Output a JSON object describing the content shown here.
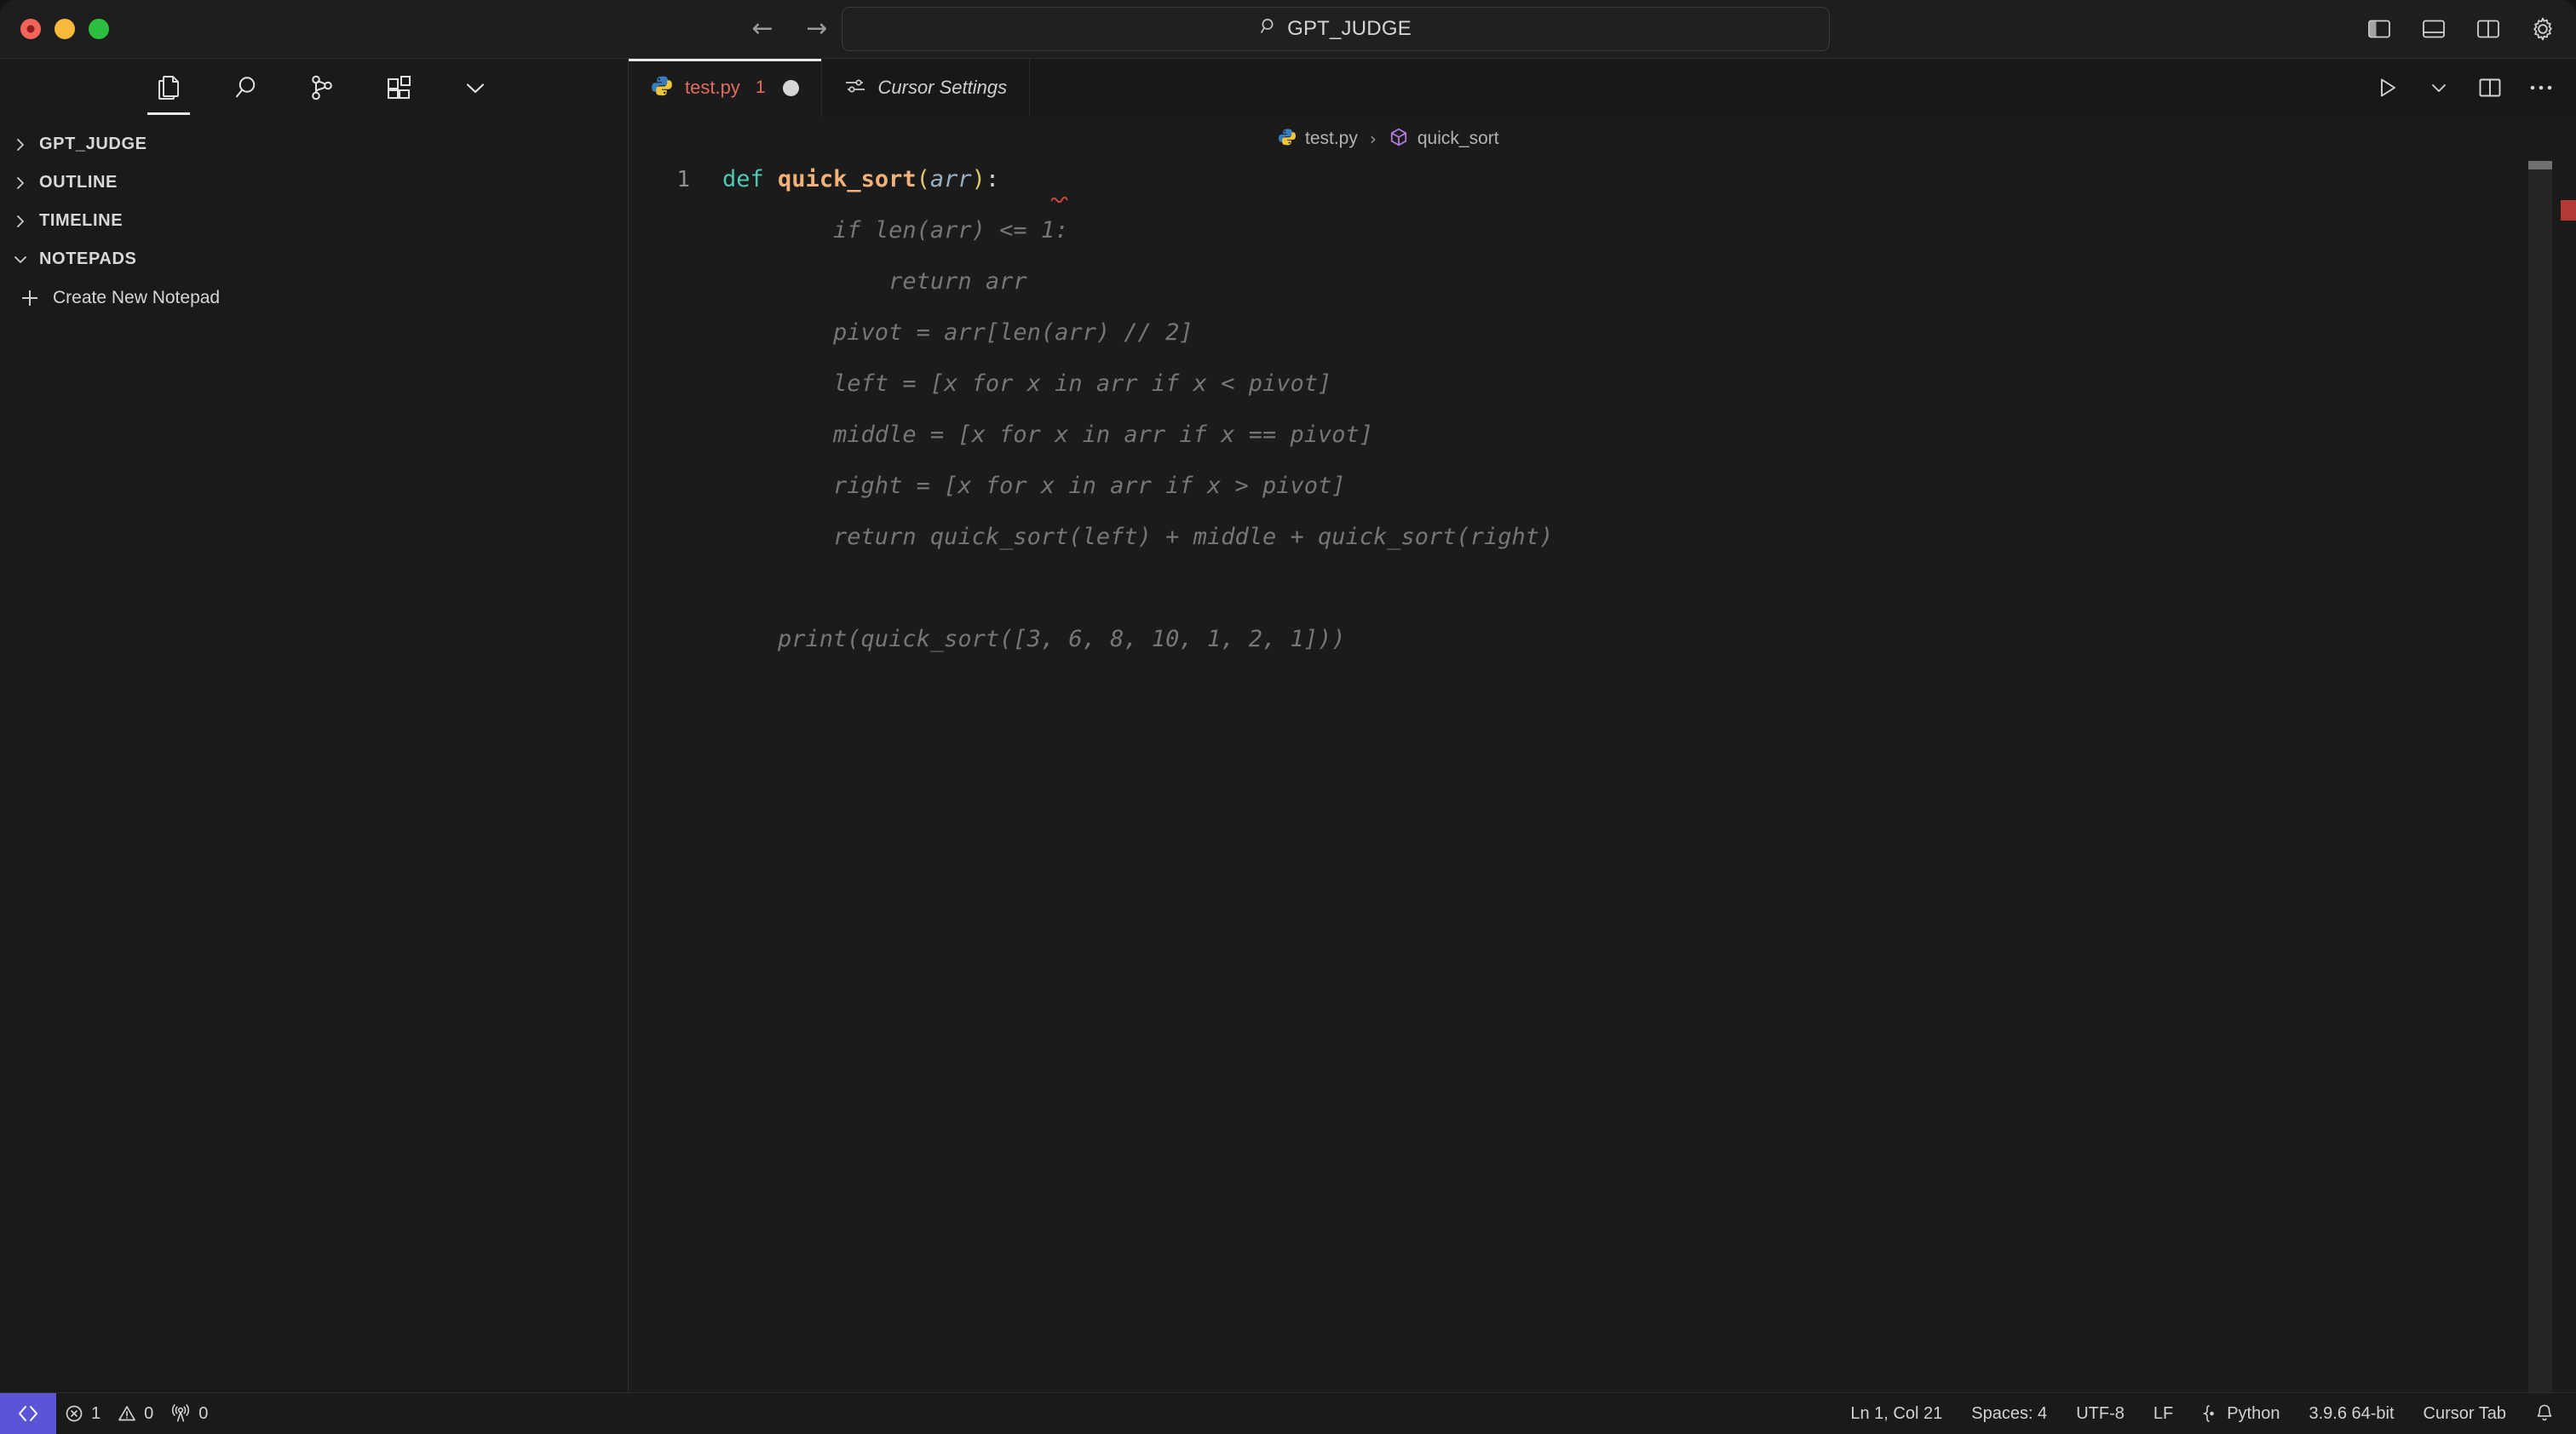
{
  "window": {
    "traffic_lights": [
      "close",
      "minimize",
      "maximize"
    ]
  },
  "titlebar": {
    "back_arrow": "←",
    "forward_arrow": "→",
    "search": {
      "icon": "search-icon",
      "value": "GPT_JUDGE"
    },
    "right_icons": [
      {
        "name": "toggle-primary-sidebar-icon",
        "title": "Toggle Primary Side Bar"
      },
      {
        "name": "toggle-panel-icon",
        "title": "Toggle Panel"
      },
      {
        "name": "toggle-secondary-sidebar-icon",
        "title": "Toggle Secondary Side Bar"
      },
      {
        "name": "settings-gear-icon",
        "title": "Manage"
      }
    ]
  },
  "activitybar": {
    "items": [
      {
        "name": "explorer-icon",
        "label": "Explorer",
        "active": true
      },
      {
        "name": "search-icon",
        "label": "Search",
        "active": false
      },
      {
        "name": "source-control-icon",
        "label": "Source Control",
        "active": false
      },
      {
        "name": "extensions-icon",
        "label": "Extensions",
        "active": false
      },
      {
        "name": "chevron-down-icon",
        "label": "More",
        "active": false
      }
    ]
  },
  "sidebar": {
    "sections": [
      {
        "label": "GPT_JUDGE",
        "expanded": false
      },
      {
        "label": "OUTLINE",
        "expanded": false
      },
      {
        "label": "TIMELINE",
        "expanded": false
      },
      {
        "label": "NOTEPADS",
        "expanded": true
      }
    ],
    "create_notepad": "Create New Notepad"
  },
  "tabs": [
    {
      "label": "test.py",
      "icon": "python-icon",
      "active": true,
      "badge": "1",
      "dirty": true
    },
    {
      "label": "Cursor Settings",
      "icon": "sliders-icon",
      "active": false,
      "badge": "",
      "dirty": false
    }
  ],
  "editor_actions": [
    {
      "name": "run-python-file-icon",
      "label": "Run Python File"
    },
    {
      "name": "chevron-down-icon",
      "label": "Run or Debug"
    },
    {
      "name": "split-editor-right-icon",
      "label": "Split Editor Right"
    },
    {
      "name": "more-actions-icon",
      "label": "More Actions"
    }
  ],
  "breadcrumb": {
    "file_icon": "python-icon",
    "file": "test.py",
    "separator": "›",
    "symbol_icon": "symbol-method-icon",
    "symbol": "quick_sort"
  },
  "editor": {
    "line_number": "1",
    "line1": {
      "kw": "def",
      "space": " ",
      "fn": "quick_sort",
      "open_paren": "(",
      "param": "arr",
      "close_paren": ")",
      "colon": ":"
    },
    "ghost_lines": [
      "        if len(arr) <= 1:",
      "            return arr",
      "        pivot = arr[len(arr) // 2]",
      "        left = [x for x in arr if x < pivot]",
      "        middle = [x for x in arr if x == pivot]",
      "        right = [x for x in arr if x > pivot]",
      "        return quick_sort(left) + middle + quick_sort(right)",
      "",
      "    print(quick_sort([3, 6, 8, 10, 1, 2, 1]))"
    ]
  },
  "statusbar": {
    "remote_icon": "remote-window-icon",
    "left": [
      {
        "name": "errors",
        "icon": "error-circle-icon",
        "value": "1"
      },
      {
        "name": "warnings",
        "icon": "warning-triangle-icon",
        "value": "0"
      },
      {
        "name": "ports",
        "icon": "radio-tower-icon",
        "value": "0"
      }
    ],
    "right": [
      {
        "name": "cursor-position",
        "value": "Ln 1, Col 21"
      },
      {
        "name": "indentation",
        "value": "Spaces: 4"
      },
      {
        "name": "encoding",
        "value": "UTF-8"
      },
      {
        "name": "eol",
        "value": "LF"
      },
      {
        "name": "language-mode",
        "value": "Python",
        "icon": "braces-icon"
      },
      {
        "name": "python-interpreter",
        "value": "3.9.6 64-bit"
      },
      {
        "name": "cursor-tab",
        "value": "Cursor Tab"
      },
      {
        "name": "notifications",
        "value": "",
        "icon": "bell-icon"
      }
    ]
  },
  "colors": {
    "accent_remote": "#5b54d6",
    "error": "#e06c63",
    "ghost_text": "#767676",
    "keyword": "#4ec9b0",
    "function": "#f0b27a"
  }
}
